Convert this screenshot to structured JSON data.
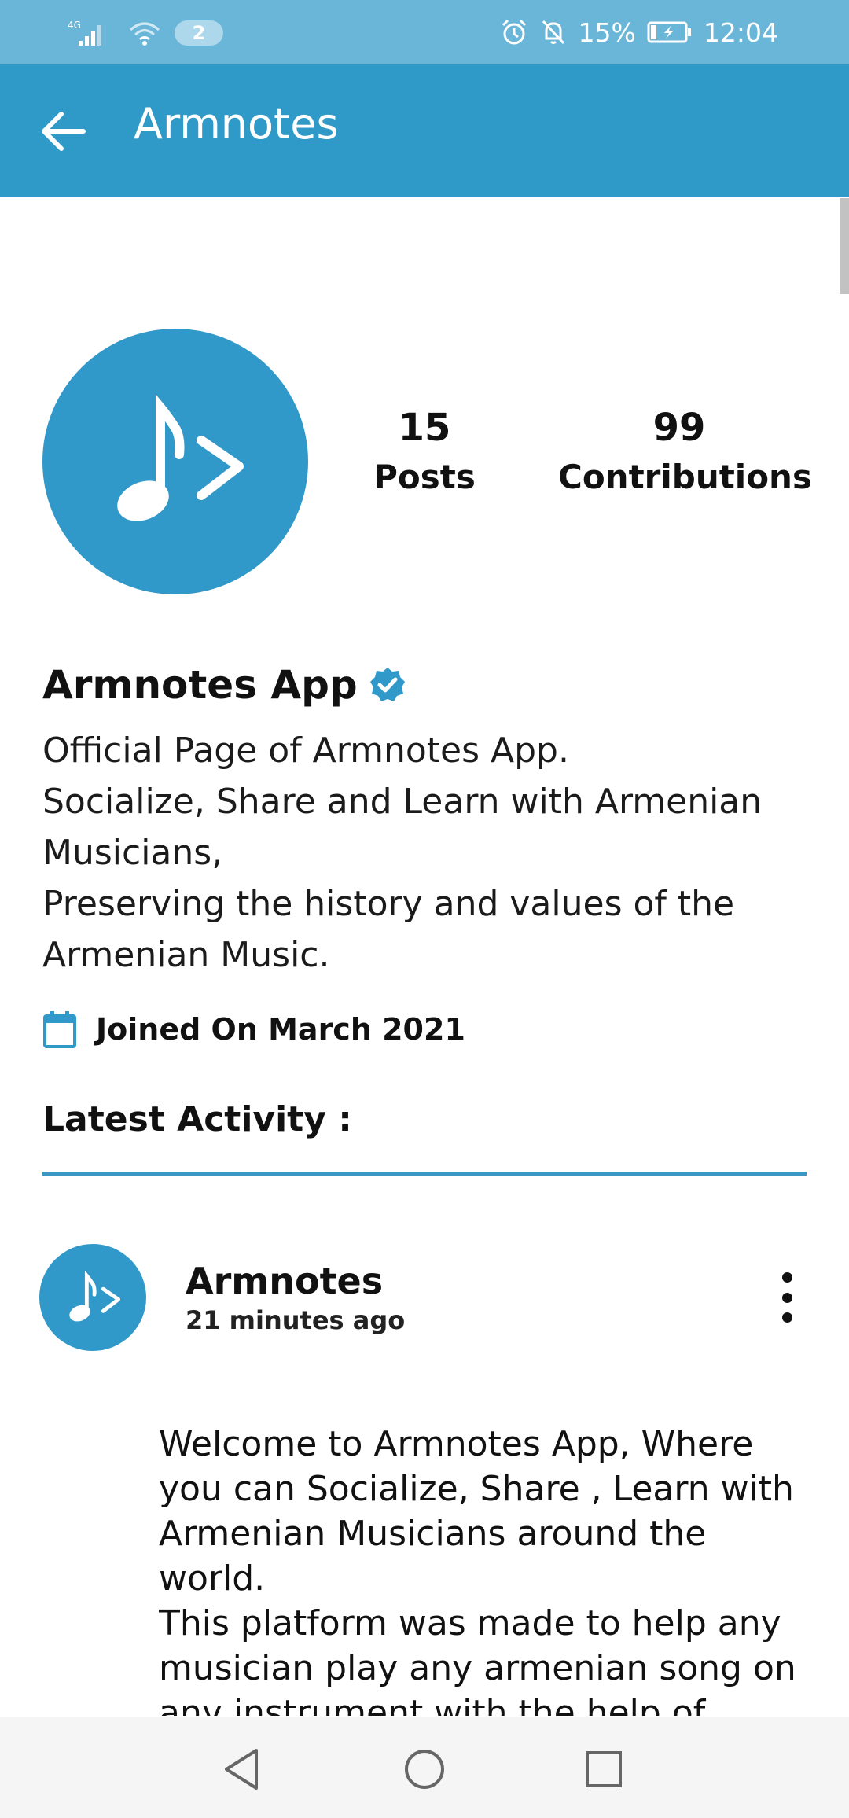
{
  "status_bar": {
    "network": "4G",
    "sim_count": "2",
    "battery": "15%",
    "time": "12:04"
  },
  "app_bar": {
    "title": "Armnotes"
  },
  "profile": {
    "posts_count": "15",
    "posts_label": "Posts",
    "contributions_count": "99",
    "contributions_label": "Contributions",
    "name": "Armnotes App",
    "bio": "Official Page of Armnotes App.\nSocialize, Share and Learn with Armenian Musicians,\nPreserving the history and values of the Armenian Music.",
    "joined": "Joined On March 2021"
  },
  "activity": {
    "section_title": "Latest Activity :",
    "post": {
      "author": "Armnotes",
      "time": "21 minutes ago",
      "body": "Welcome to Armnotes App, Where you can Socialize, Share , Learn with Armenian Musicians around the world.\nThis platform was made to help any musician play any armenian song on any instrument with the help of other"
    }
  },
  "colors": {
    "status_bar": "#6ab6d9",
    "app_bar": "#2f9ac8",
    "accent": "#3199c9",
    "divider": "#3a97c3"
  },
  "icons": {
    "back": "arrow-left-icon",
    "verified": "verified-badge-icon",
    "calendar": "calendar-icon",
    "more": "more-vertical-icon",
    "logo": "armnotes-logo-icon"
  }
}
